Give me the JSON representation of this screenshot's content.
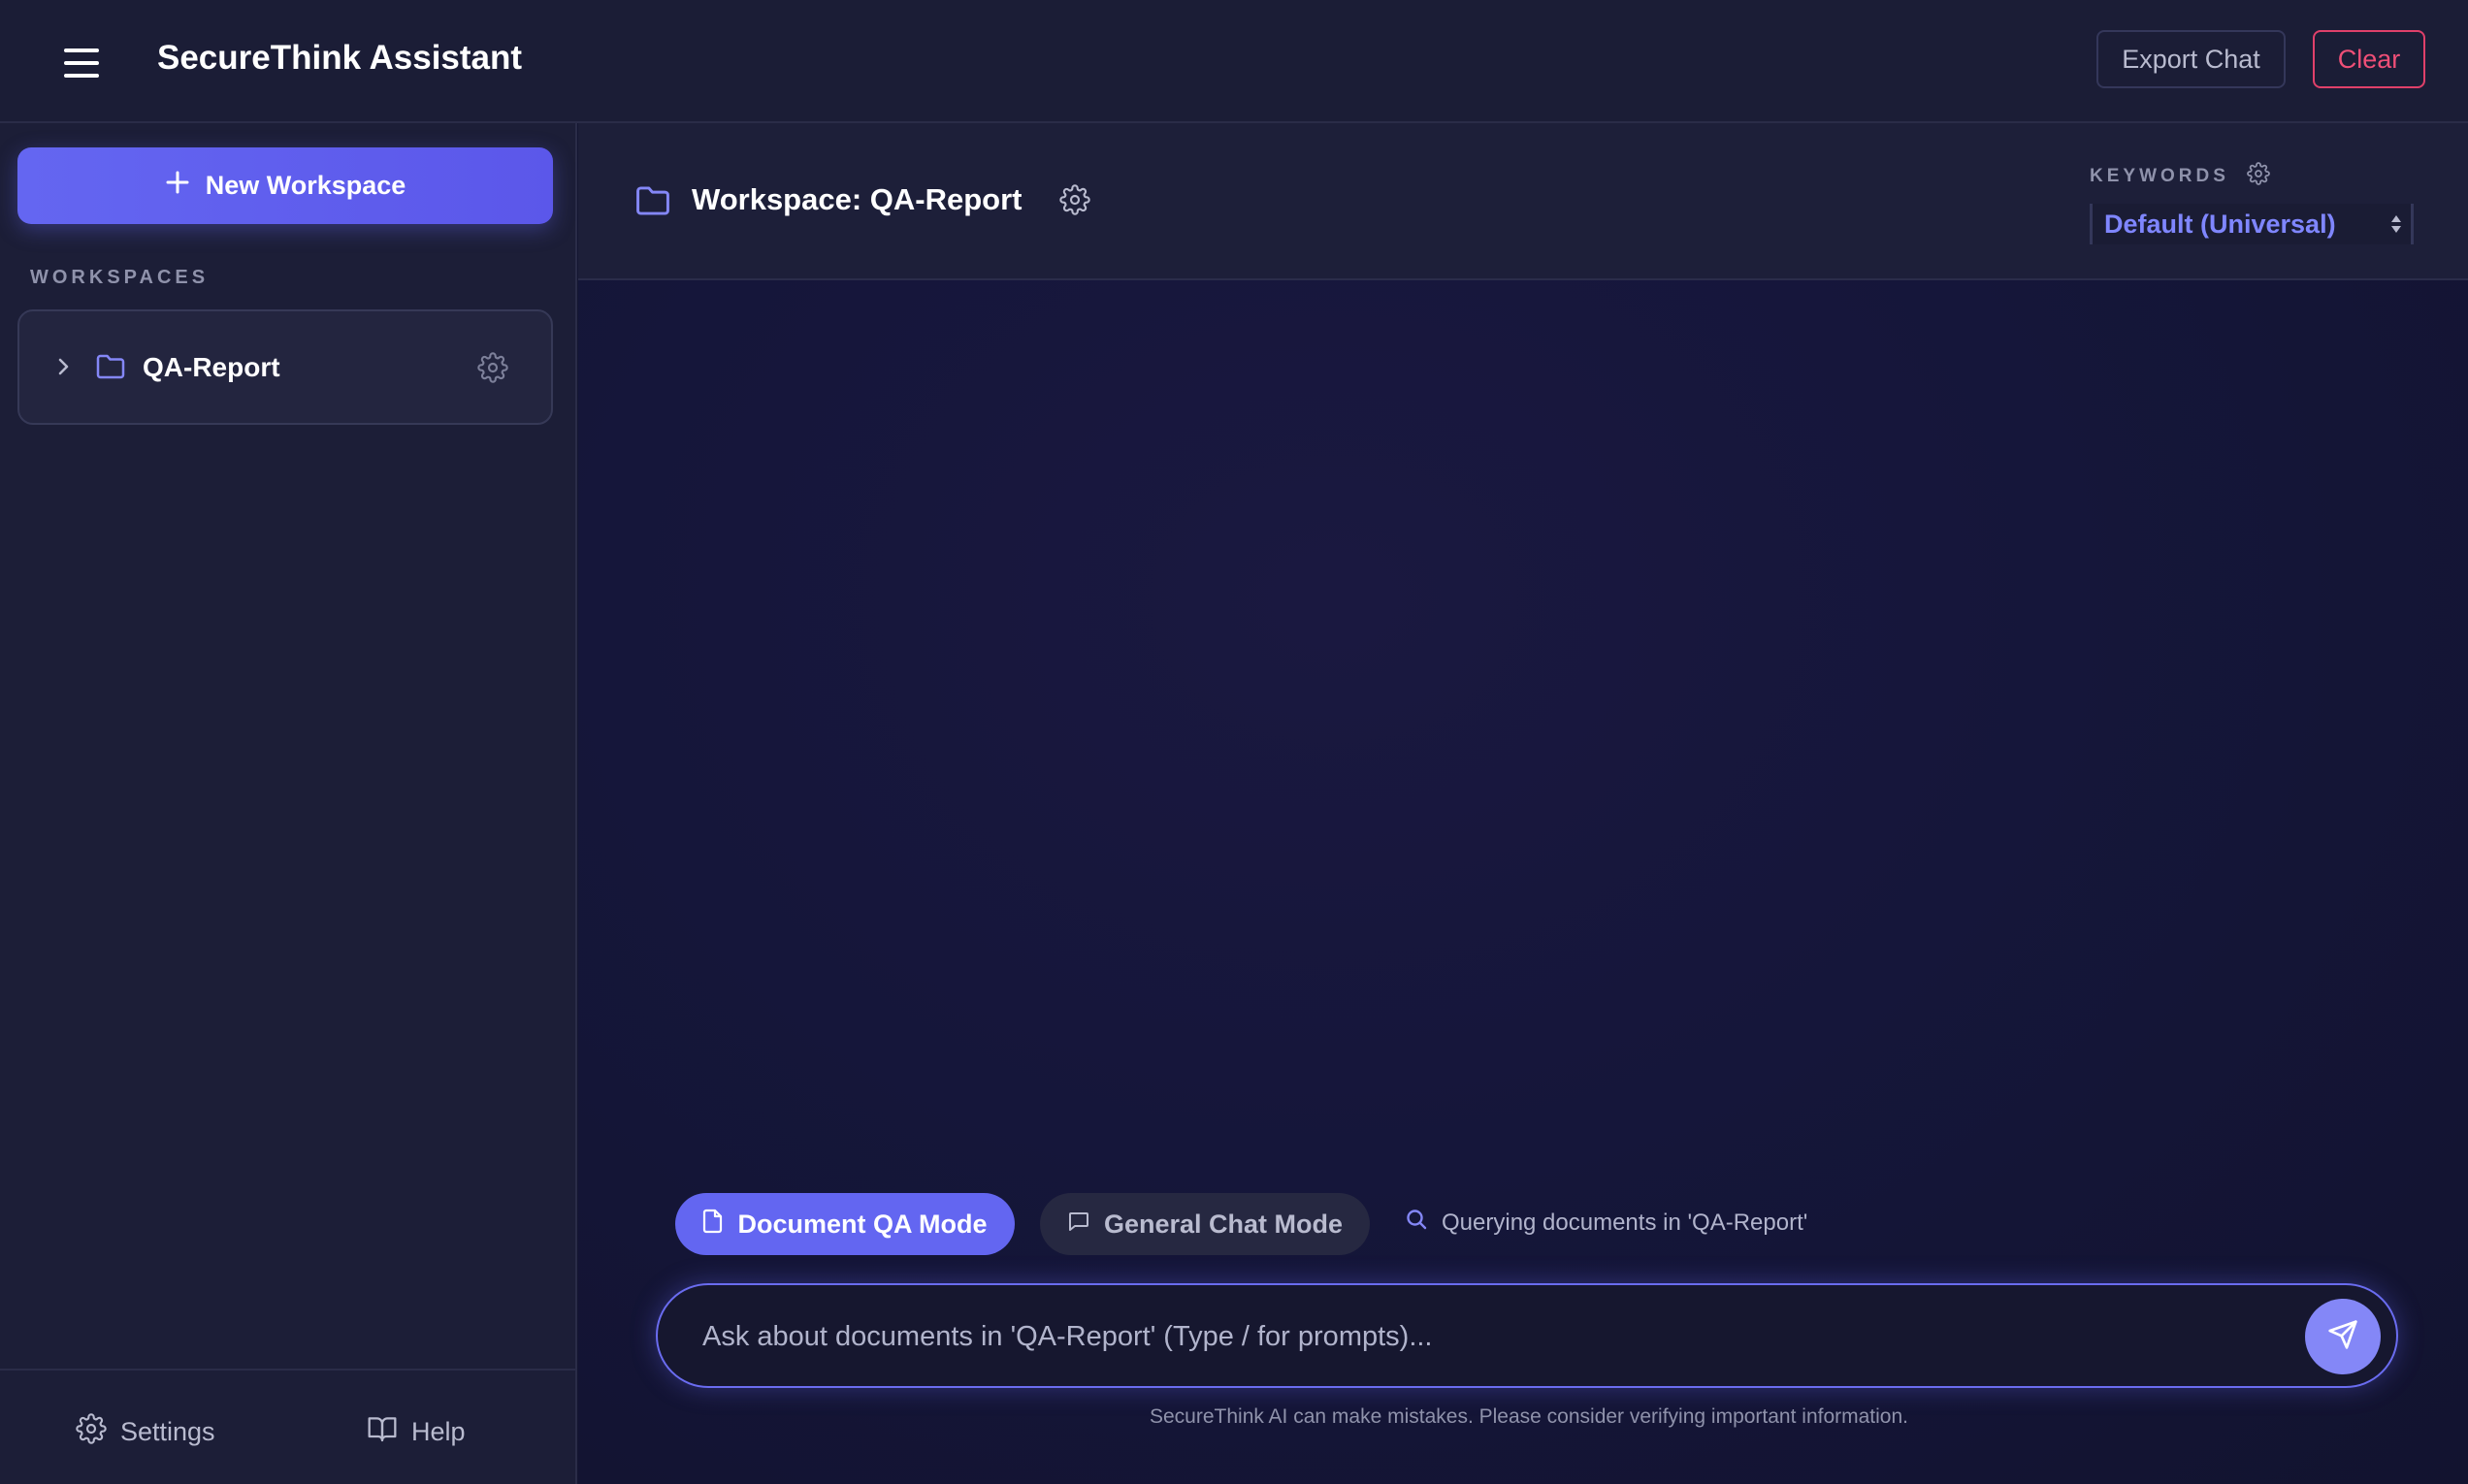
{
  "header": {
    "app_title": "SecureThink Assistant",
    "menu_icon": "hamburger-menu-icon",
    "export_label": "Export Chat",
    "clear_label": "Clear"
  },
  "sidebar": {
    "new_workspace_label": "New Workspace",
    "workspaces_heading": "WORKSPACES",
    "workspaces": [
      {
        "name": "QA-Report",
        "expanded": false
      }
    ],
    "footer": {
      "settings_label": "Settings",
      "help_label": "Help"
    }
  },
  "workspace_header": {
    "title": "Workspace: QA-Report",
    "keywords_label": "KEYWORDS",
    "keywords_selected": "Default (Universal)"
  },
  "modes": {
    "qa_label": "Document QA Mode",
    "chat_label": "General Chat Mode",
    "active": "Document QA Mode",
    "status_text": "Querying documents in 'QA-Report'"
  },
  "composer": {
    "placeholder": "Ask about documents in 'QA-Report' (Type / for prompts)...",
    "value": ""
  },
  "disclaimer": "SecureThink AI can make mistakes. Please consider verifying important information.",
  "colors": {
    "accent": "#6366f1",
    "danger": "#ef4f77",
    "background": "#141631",
    "panel": "#1c1e37"
  }
}
